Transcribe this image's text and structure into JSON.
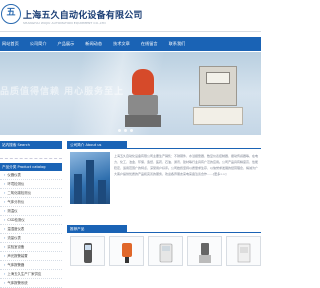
{
  "header": {
    "logo_glyph": "五",
    "company_name": "上海五久自动化设备有限公司",
    "company_en": "SHANGHAI WUJIU AUTOMATION EQUIPMENT CO.,LTD"
  },
  "nav": {
    "items": [
      "网站首页",
      "公司简介",
      "产品展示",
      "新闻动态",
      "技术文章",
      "在线留言",
      "联系我们"
    ]
  },
  "banner": {
    "slogan": "品质值得信赖 用心服务至上"
  },
  "sidebar": {
    "search_title": "站内搜索 Search",
    "category_title": "产品分类 Product catalog",
    "categories": [
      "仪器仪表",
      "环境检测仪",
      "二氧化碳检测仪",
      "气体分析仪",
      "测温仪",
      "CSD检测仪",
      "温湿度仪表",
      "流量仪表",
      "实验室设备",
      "声光报警装置",
      "气体报警器",
      "上海五久生产厂家供应",
      "气体报警系统"
    ]
  },
  "about": {
    "title": "公司简介 About us",
    "text": "上海五久自动化设备有限公司主要生产销售：不锈钢件、水浸报警器、数显仪表控制器、振动传感器等，在电力、化工、冶金、环保、造纸、医药、石油、通讯、建材等行业具有广泛的应用。公司产品具有精度高、性能稳定、适用范围广的特点，深受用户好评。公司始终坚持以质量求生存、以信誉求发展的经营理念，竭诚为广大客户提供优质的产品和完善的服务，欢迎各界朋友来电来函洽谈合作……[更多>>]"
  },
  "products": {
    "title": "推荐产品",
    "more": "更多>>"
  },
  "colors": {
    "brand_blue": "#1a63b5",
    "title_navy": "#1b3e75"
  }
}
